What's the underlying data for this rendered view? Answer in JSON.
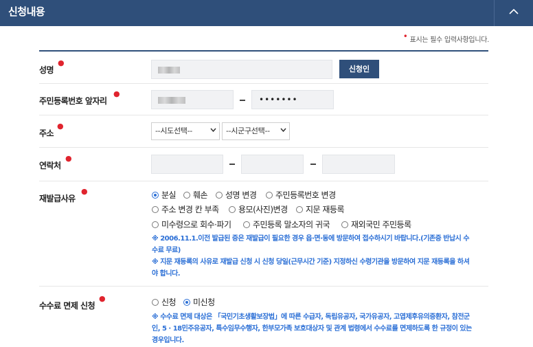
{
  "header": {
    "title": "신청내용"
  },
  "required_note": "표시는 필수 입력사항입니다.",
  "form": {
    "name": {
      "label": "성명",
      "button": "신청인"
    },
    "resident_id": {
      "label": "주민등록번호 앞자리",
      "masked": "•••••••"
    },
    "address": {
      "label": "주소",
      "sido": "--시도선택--",
      "sigungu": "--시군구선택--"
    },
    "contact": {
      "label": "연락처"
    },
    "reason": {
      "label": "재발급사유",
      "options": [
        "분실",
        "훼손",
        "성명 변경",
        "주민등록번호 변경",
        "주소 변경 칸 부족",
        "용모(사진)변경",
        "지문 재등록",
        "미수령으로 회수·파기",
        "주민등록 말소자의 귀국",
        "재외국민 주민등록"
      ],
      "selected": "분실",
      "note1_line1": "※ 2006.11.1.이전 발급된 증은 재발급이 필요한 경우 읍·면·동에 방문하여 접수하시기 바랍니다.(기존증 반납시 수",
      "note1_line2": "수료 무료)",
      "note2_line1": "※ 지문 재등록의 사유로 재발급 신청 시 신청 당일(근무시간 기준) 지정하신 수령기관을 방문하여 지문 재등록을 하셔",
      "note2_line2": "야 합니다."
    },
    "fee": {
      "label": "수수료 면제 신청",
      "options": [
        "신청",
        "미신청"
      ],
      "selected": "미신청",
      "note_line1": "※ 수수료 면제 대상은 「국민기초생활보장법」에 따른 수급자, 독립유공자, 국가유공자, 고엽제후유의증환자, 참전군",
      "note_line2": "인, 5 · 18민주유공자, 특수임무수행자, 한부모가족 보호대상자 및 관계 법령에서 수수료를 면제하도록 한 규정이 있는",
      "note_line3": "경우입니다."
    }
  },
  "colors": {
    "header_bg": "#2f4f7a",
    "required": "#e0242e",
    "note": "#2b6fd6"
  }
}
